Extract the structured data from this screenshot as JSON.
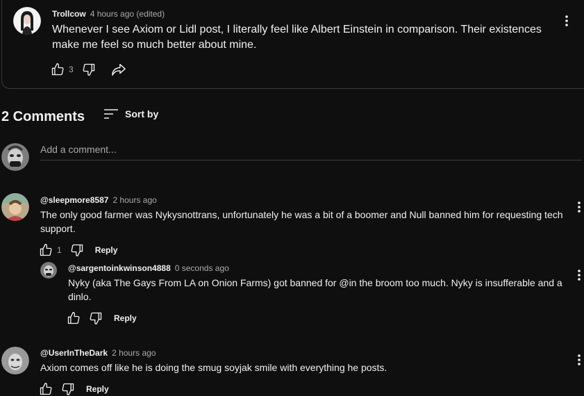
{
  "post": {
    "author": "Trollcow",
    "time": "4 hours ago (edited)",
    "text": "Whenever I see Axiom or Lidl post, I literally feel like Albert Einstein in comparison. Their existences make me feel so much better about mine.",
    "likes": "3"
  },
  "comments_header": {
    "count_label": "2 Comments",
    "sort_label": "Sort by"
  },
  "add_comment": {
    "placeholder": "Add a comment..."
  },
  "comments": [
    {
      "author": "@sleepmore8587",
      "time": "2 hours ago",
      "text": "The only good farmer was Nykysnottrans, unfortunately he was a bit of a boomer and Null banned him for requesting tech support.",
      "likes": "1",
      "reply_label": "Reply"
    },
    {
      "author": "@sargentoinkwinson4888",
      "time": "0 seconds ago",
      "text": "Nyky (aka The Gays From LA on Onion Farms) got banned for @in the broom too much. Nyky is insufferable and a dinlo.",
      "likes": "",
      "reply_label": "Reply"
    },
    {
      "author": "@UserInTheDark",
      "time": "2 hours ago",
      "text": "Axiom comes off like he is doing the smug soyjak smile with everything he posts.",
      "likes": "",
      "reply_label": "Reply"
    }
  ],
  "colors": {
    "background": "#0f0f0f",
    "text": "#f1f1f1",
    "muted": "#aaaaaa",
    "divider": "#3f3f3f"
  }
}
